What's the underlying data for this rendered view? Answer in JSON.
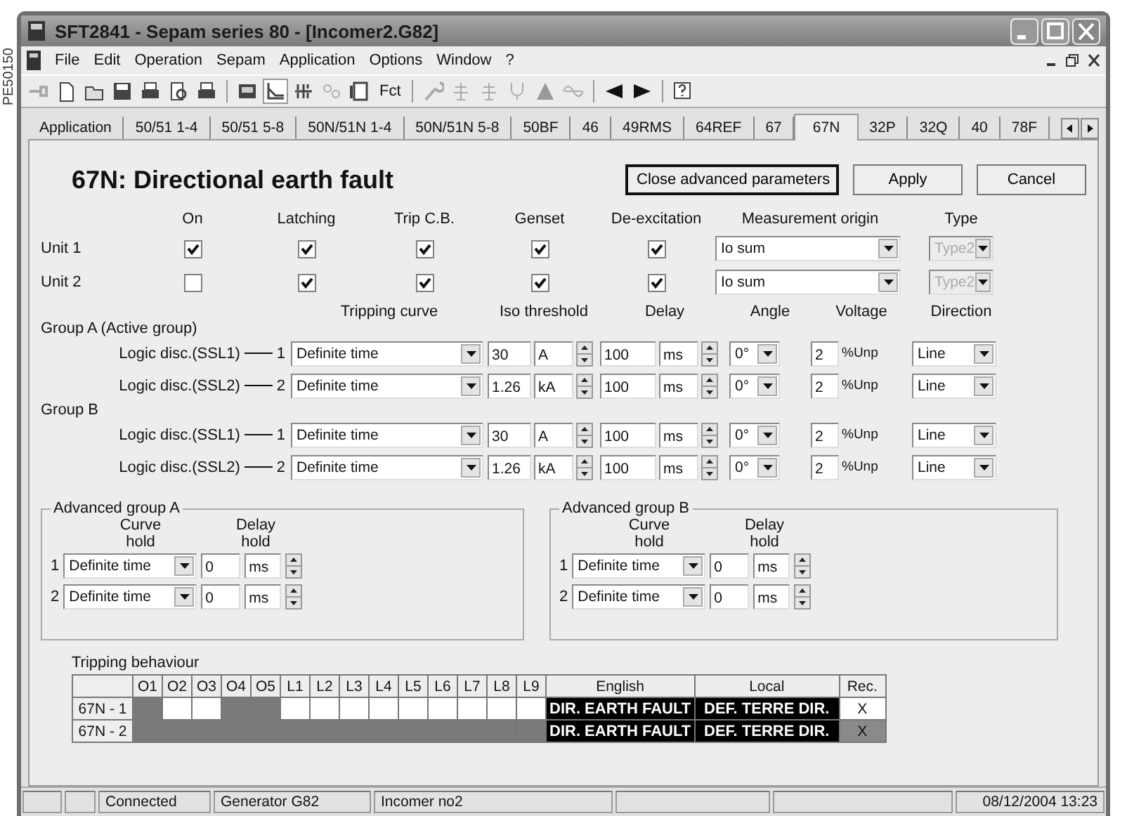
{
  "side_code": "PE50150",
  "window": {
    "title": "SFT2841 - Sepam series 80 - [Incomer2.G82]"
  },
  "menu": [
    "File",
    "Edit",
    "Operation",
    "Sepam",
    "Application",
    "Options",
    "Window",
    "?"
  ],
  "toolbar": {
    "text_button": "Fct"
  },
  "tabs": [
    {
      "label": "Application",
      "selected": false
    },
    {
      "label": "50/51 1-4",
      "selected": false
    },
    {
      "label": "50/51 5-8",
      "selected": false
    },
    {
      "label": "50N/51N 1-4",
      "selected": false
    },
    {
      "label": "50N/51N 5-8",
      "selected": false
    },
    {
      "label": "50BF",
      "selected": false
    },
    {
      "label": "46",
      "selected": false
    },
    {
      "label": "49RMS",
      "selected": false
    },
    {
      "label": "64REF",
      "selected": false
    },
    {
      "label": "67",
      "selected": false
    },
    {
      "label": "67N",
      "selected": true
    },
    {
      "label": "32P",
      "selected": false
    },
    {
      "label": "32Q",
      "selected": false
    },
    {
      "label": "40",
      "selected": false
    },
    {
      "label": "78F",
      "selected": false
    }
  ],
  "page": {
    "title": "67N: Directional earth fault",
    "buttons": [
      {
        "label": "Close advanced parameters",
        "default": true
      },
      {
        "label": "Apply",
        "default": false
      },
      {
        "label": "Cancel",
        "default": false
      }
    ]
  },
  "units": {
    "columns": [
      "On",
      "Latching",
      "Trip C.B.",
      "Genset",
      "De-excitation",
      "Measurement origin",
      "Type"
    ],
    "rows": [
      {
        "label": "Unit 1",
        "checks": [
          true,
          true,
          true,
          true,
          true
        ],
        "measurement": "Io sum",
        "type": {
          "value": "Type2",
          "disabled": true
        }
      },
      {
        "label": "Unit 2",
        "checks": [
          false,
          true,
          true,
          true,
          true
        ],
        "measurement": "Io sum",
        "type": {
          "value": "Type2",
          "disabled": true
        }
      }
    ]
  },
  "group_columns": [
    "Tripping curve",
    "Iso threshold",
    "Delay",
    "Angle",
    "Voltage",
    "Direction"
  ],
  "groups": [
    {
      "label": "Group A  (Active group)",
      "rows": [
        {
          "label": "Logic disc.(SSL1)",
          "index": "1",
          "curve": "Definite time",
          "threshold": "30",
          "threshold_unit": "A",
          "delay": "100",
          "delay_unit": "ms",
          "angle": "0°",
          "voltage": "2",
          "voltage_unit": "%Unp",
          "direction": "Line"
        },
        {
          "label": "Logic disc.(SSL2)",
          "index": "2",
          "curve": "Definite time",
          "threshold": "1.26",
          "threshold_unit": "kA",
          "delay": "100",
          "delay_unit": "ms",
          "angle": "0°",
          "voltage": "2",
          "voltage_unit": "%Unp",
          "direction": "Line"
        }
      ]
    },
    {
      "label": "Group B",
      "rows": [
        {
          "label": "Logic disc.(SSL1)",
          "index": "1",
          "curve": "Definite time",
          "threshold": "30",
          "threshold_unit": "A",
          "delay": "100",
          "delay_unit": "ms",
          "angle": "0°",
          "voltage": "2",
          "voltage_unit": "%Unp",
          "direction": "Line"
        },
        {
          "label": "Logic disc.(SSL2)",
          "index": "2",
          "curve": "Definite time",
          "threshold": "1.26",
          "threshold_unit": "kA",
          "delay": "100",
          "delay_unit": "ms",
          "angle": "0°",
          "voltage": "2",
          "voltage_unit": "%Unp",
          "direction": "Line"
        }
      ]
    }
  ],
  "advanced_groups": [
    {
      "title": "Advanced group A",
      "columns": [
        "Curve hold",
        "Delay hold"
      ],
      "rows": [
        {
          "index": "1",
          "curve": "Definite time",
          "delay": "0",
          "unit": "ms"
        },
        {
          "index": "2",
          "curve": "Definite time",
          "delay": "0",
          "unit": "ms"
        }
      ]
    },
    {
      "title": "Advanced group B",
      "columns": [
        "Curve hold",
        "Delay hold"
      ],
      "rows": [
        {
          "index": "1",
          "curve": "Definite time",
          "delay": "0",
          "unit": "ms"
        },
        {
          "index": "2",
          "curve": "Definite time",
          "delay": "0",
          "unit": "ms"
        }
      ]
    }
  ],
  "tripping": {
    "title": "Tripping behaviour",
    "outputs": [
      "O1",
      "O2",
      "O3",
      "O4",
      "O5",
      "L1",
      "L2",
      "L3",
      "L4",
      "L5",
      "L6",
      "L7",
      "L8",
      "L9"
    ],
    "english_header": "English",
    "local_header": "Local",
    "rec_header": "Rec.",
    "rows": [
      {
        "label": "67N - 1",
        "disabled": false,
        "cells": [
          true,
          false,
          false,
          true,
          true,
          false,
          false,
          false,
          false,
          false,
          false,
          false,
          false,
          false
        ],
        "english": "DIR. EARTH FAULT",
        "local": "DEF. TERRE DIR.",
        "rec": "X"
      },
      {
        "label": "67N - 2",
        "disabled": true,
        "cells": [
          true,
          true,
          true,
          true,
          true,
          true,
          true,
          true,
          true,
          true,
          true,
          true,
          true,
          true
        ],
        "english": "DIR. EARTH FAULT",
        "local": "DEF. TERRE DIR.",
        "rec": "X"
      }
    ]
  },
  "status_bar": [
    {
      "kind": "blank"
    },
    {
      "kind": "blank"
    },
    {
      "kind": "text",
      "text": "Connected"
    },
    {
      "kind": "text",
      "text": "Generator G82"
    },
    {
      "kind": "text",
      "text": "Incomer no2"
    },
    {
      "kind": "blank"
    },
    {
      "kind": "blank"
    },
    {
      "kind": "text",
      "text": "08/12/2004 13:23"
    }
  ]
}
